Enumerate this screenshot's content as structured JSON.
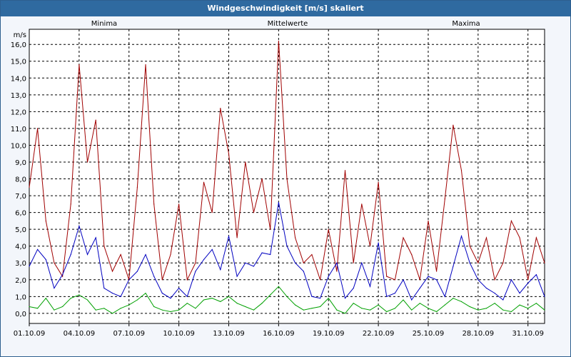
{
  "window": {
    "title": "Windgeschwindigkeit [m/s] skaliert"
  },
  "chart_data": {
    "type": "line",
    "title": "Windgeschwindigkeit [m/s] skaliert",
    "ylabel": "m/s",
    "xlabel": "",
    "ylim": [
      -0.6,
      16.9
    ],
    "y_ticks": [
      "0,0",
      "1,0",
      "2,0",
      "3,0",
      "4,0",
      "5,0",
      "6,0",
      "7,0",
      "8,0",
      "9,0",
      "10,0",
      "11,0",
      "12,0",
      "13,0",
      "14,0",
      "15,0",
      "16,0"
    ],
    "x_ticks": [
      "01.10.09",
      "04.10.09",
      "07.10.09",
      "10.10.09",
      "13.10.09",
      "16.10.09",
      "19.10.09",
      "22.10.09",
      "25.10.09",
      "28.10.09",
      "31.10.09"
    ],
    "xlim_days": [
      1,
      32
    ],
    "grid": true,
    "legend_position": "top",
    "series": [
      {
        "name": "Minima",
        "color": "#00a000",
        "x": [
          1,
          1.5,
          2,
          2.5,
          3,
          3.5,
          4,
          4.5,
          5,
          5.5,
          6,
          6.5,
          7,
          7.5,
          8,
          8.5,
          9,
          9.5,
          10,
          10.5,
          11,
          11.5,
          12,
          12.5,
          13,
          13.5,
          14,
          14.5,
          15,
          15.5,
          16,
          16.5,
          17,
          17.5,
          18,
          18.5,
          19,
          19.5,
          20,
          20.5,
          21,
          21.5,
          22,
          22.5,
          23,
          23.5,
          24,
          24.5,
          25,
          25.5,
          26,
          26.5,
          27,
          27.5,
          28,
          28.5,
          29,
          29.5,
          30,
          30.5,
          31,
          31.5,
          32
        ],
        "values": [
          0.4,
          0.3,
          0.9,
          0.2,
          0.4,
          0.9,
          1.1,
          0.8,
          0.2,
          0.3,
          0.0,
          0.3,
          0.5,
          0.8,
          1.2,
          0.4,
          0.2,
          0.1,
          0.2,
          0.6,
          0.3,
          0.8,
          0.9,
          0.7,
          1.0,
          0.6,
          0.4,
          0.2,
          0.6,
          1.1,
          1.6,
          1.0,
          0.5,
          0.2,
          0.3,
          0.4,
          0.9,
          0.2,
          0.0,
          0.6,
          0.3,
          0.2,
          0.5,
          0.1,
          0.3,
          0.8,
          0.2,
          0.6,
          0.3,
          0.1,
          0.5,
          0.9,
          0.7,
          0.4,
          0.2,
          0.3,
          0.6,
          0.2,
          0.1,
          0.5,
          0.3,
          0.6,
          0.2
        ]
      },
      {
        "name": "Mittelwerte",
        "color": "#0000c0",
        "x": [
          1,
          1.5,
          2,
          2.5,
          3,
          3.5,
          4,
          4.5,
          5,
          5.5,
          6,
          6.5,
          7,
          7.5,
          8,
          8.5,
          9,
          9.5,
          10,
          10.5,
          11,
          11.5,
          12,
          12.5,
          13,
          13.5,
          14,
          14.5,
          15,
          15.5,
          16,
          16.5,
          17,
          17.5,
          18,
          18.5,
          19,
          19.5,
          20,
          20.5,
          21,
          21.5,
          22,
          22.5,
          23,
          23.5,
          24,
          24.5,
          25,
          25.5,
          26,
          26.5,
          27,
          27.5,
          28,
          28.5,
          29,
          29.5,
          30,
          30.5,
          31,
          31.5,
          32
        ],
        "values": [
          2.8,
          3.8,
          3.2,
          1.5,
          2.3,
          3.5,
          5.2,
          3.5,
          4.5,
          1.5,
          1.2,
          1.0,
          2.0,
          2.5,
          3.5,
          2.2,
          1.2,
          0.9,
          1.5,
          1.0,
          2.5,
          3.2,
          3.8,
          2.6,
          4.6,
          2.2,
          3.0,
          2.8,
          3.6,
          3.5,
          6.6,
          4.0,
          3.0,
          2.5,
          1.0,
          0.9,
          2.2,
          3.0,
          0.9,
          1.5,
          3.0,
          1.6,
          4.2,
          1.0,
          1.2,
          2.0,
          0.8,
          1.5,
          2.2,
          2.0,
          1.0,
          2.8,
          4.6,
          3.0,
          2.0,
          1.5,
          1.2,
          0.8,
          2.0,
          1.2,
          1.8,
          2.3,
          1.0
        ]
      },
      {
        "name": "Maxima",
        "color": "#a00000",
        "x": [
          1,
          1.5,
          2,
          2.5,
          3,
          3.5,
          4,
          4.5,
          5,
          5.5,
          6,
          6.5,
          7,
          7.5,
          8,
          8.5,
          9,
          9.5,
          10,
          10.5,
          11,
          11.5,
          12,
          12.5,
          13,
          13.5,
          14,
          14.5,
          15,
          15.5,
          16,
          16.5,
          17,
          17.5,
          18,
          18.5,
          19,
          19.5,
          20,
          20.5,
          21,
          21.5,
          22,
          22.5,
          23,
          23.5,
          24,
          24.5,
          25,
          25.5,
          26,
          26.5,
          27,
          27.5,
          28,
          28.5,
          29,
          29.5,
          30,
          30.5,
          31,
          31.5,
          32
        ],
        "values": [
          7.5,
          11.0,
          5.5,
          3.0,
          2.2,
          6.5,
          14.8,
          9.0,
          11.5,
          4.0,
          2.5,
          3.5,
          2.0,
          7.5,
          14.8,
          6.5,
          2.0,
          3.5,
          6.5,
          2.0,
          3.0,
          7.8,
          6.0,
          12.2,
          9.5,
          4.5,
          9.0,
          6.0,
          8.0,
          5.0,
          16.2,
          8.0,
          4.5,
          3.0,
          3.5,
          2.0,
          5.0,
          2.5,
          8.5,
          3.0,
          6.5,
          4.0,
          7.8,
          2.2,
          2.0,
          4.5,
          3.5,
          2.0,
          5.5,
          2.5,
          6.8,
          11.2,
          8.5,
          4.0,
          3.0,
          4.5,
          2.0,
          3.0,
          5.5,
          4.5,
          2.0,
          4.5,
          3.0
        ]
      }
    ]
  }
}
